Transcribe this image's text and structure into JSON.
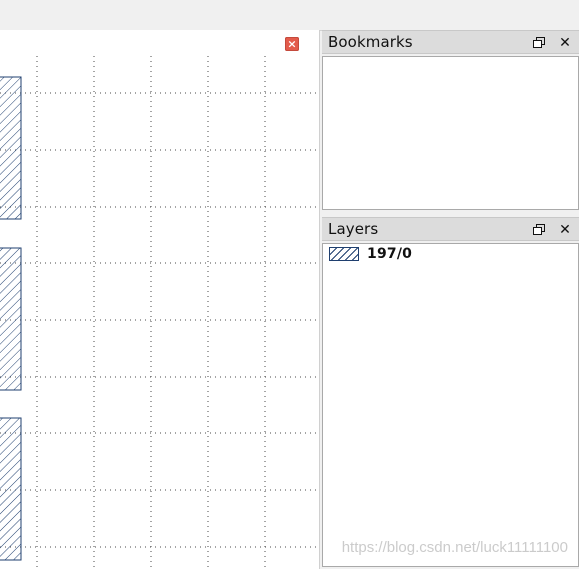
{
  "colors": {
    "canvas_bg": "#ffffff",
    "grid_dot": "#4a4a4a",
    "shape_stroke": "#1f3f6f",
    "dock_header_bg": "#dcdcdc",
    "dock_body_bg": "#ffffff",
    "close_button_bg": "#e35b4b"
  },
  "canvas": {
    "close_icon": "close-icon"
  },
  "bookmarks": {
    "title": "Bookmarks",
    "float_icon": "restore-window-icon",
    "close_icon": "close-icon"
  },
  "layers": {
    "title": "Layers",
    "float_icon": "restore-window-icon",
    "close_icon": "close-icon",
    "items": [
      {
        "label": "197/0",
        "swatch": "hatched-swatch-icon"
      }
    ]
  },
  "watermark": {
    "text": "https://blog.csdn.net/luck11111100"
  }
}
